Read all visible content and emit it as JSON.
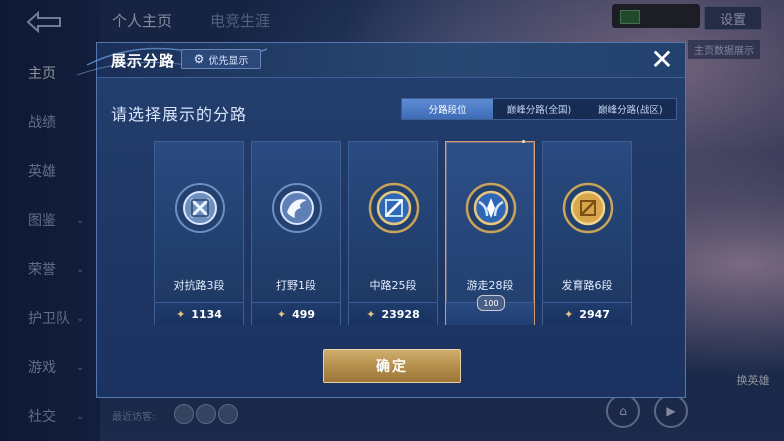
{
  "background": {
    "top_tabs": [
      "个人主页",
      "电竞生涯"
    ],
    "rail_items": [
      {
        "label": "主页",
        "active": true,
        "chevron": false
      },
      {
        "label": "战绩",
        "active": false,
        "chevron": false
      },
      {
        "label": "英雄",
        "active": false,
        "chevron": false
      },
      {
        "label": "图鉴",
        "active": false,
        "chevron": true
      },
      {
        "label": "荣誉",
        "active": false,
        "chevron": true
      },
      {
        "label": "护卫队",
        "active": false,
        "chevron": true
      },
      {
        "label": "游戏",
        "active": false,
        "chevron": true
      },
      {
        "label": "社交",
        "active": false,
        "chevron": true
      }
    ],
    "wallet_text": "",
    "settings_label": "设置",
    "peek_label": "主页数据展示",
    "visitors_label": "最近访客:",
    "character_label": "换英雄"
  },
  "modal": {
    "title": "展示分路",
    "priority_label": "优先显示",
    "close_glyph": "✕",
    "subtitle": "请选择展示的分路",
    "segments": [
      {
        "label": "分路段位",
        "active": true
      },
      {
        "label": "巅峰分路(全国)",
        "active": false
      },
      {
        "label": "巅峰分路(战区)",
        "active": false
      }
    ],
    "cards": [
      {
        "lane": "对抗路3段",
        "score": "1134",
        "selected": false,
        "emblem": "clash-lane-emblem-icon"
      },
      {
        "lane": "打野1段",
        "score": "499",
        "selected": false,
        "emblem": "jungle-emblem-icon"
      },
      {
        "lane": "中路25段",
        "score": "23928",
        "selected": false,
        "emblem": "mid-lane-emblem-icon"
      },
      {
        "lane": "游走28段",
        "score": "",
        "selected": true,
        "badge": "100",
        "emblem": "roam-emblem-icon"
      },
      {
        "lane": "发育路6段",
        "score": "2947",
        "selected": false,
        "emblem": "farm-lane-emblem-icon"
      }
    ],
    "confirm_label": "确定"
  },
  "colors": {
    "accent_blue": "#3e6bb6",
    "gold": "#b58f4d",
    "selected_border": "#d49a74"
  }
}
